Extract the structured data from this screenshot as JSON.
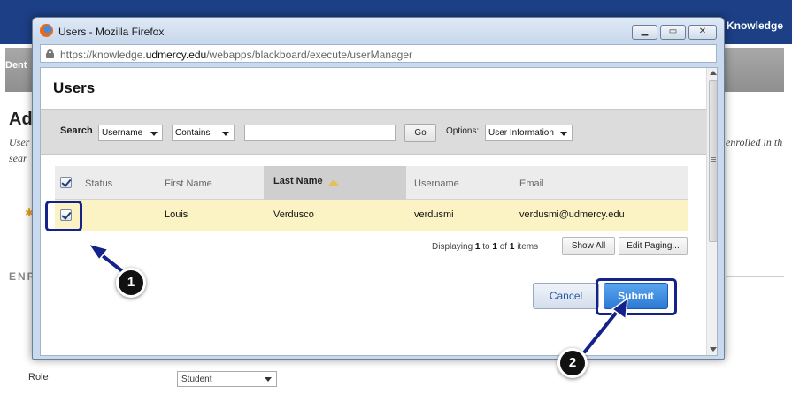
{
  "background_page": {
    "brand_text": "Knowledge",
    "nav_text": "Dent",
    "heading": "Ad",
    "desc_line1": "User",
    "desc_line2": "sear",
    "desc_right": "enrolled in th",
    "section_label": "ENR",
    "role_label": "Role",
    "role_value": "Student"
  },
  "window": {
    "title": "Users - Mozilla Firefox",
    "url_prefix": "https://knowledge.",
    "url_domain": "udmercy.edu",
    "url_suffix": "/webapps/blackboard/execute/userManager"
  },
  "dialog": {
    "title": "Users",
    "search": {
      "label": "Search",
      "field_value": "Username",
      "operator_value": "Contains",
      "query": "",
      "go_label": "Go",
      "options_label": "Options:",
      "options_value": "User Information"
    },
    "table": {
      "columns": [
        "Status",
        "First Name",
        "Last Name",
        "Username",
        "Email"
      ],
      "sorted_column": "Last Name",
      "rows": [
        {
          "checked": true,
          "status": "",
          "first_name": "Louis",
          "last_name": "Verdusco",
          "username": "verdusmi",
          "email": "verdusmi@udmercy.edu"
        }
      ]
    },
    "paging": {
      "prefix": "Displaying ",
      "from": "1",
      "to_word": " to ",
      "to": "1",
      "of_word": " of ",
      "total": "1",
      "suffix": " items",
      "show_all_label": "Show All",
      "edit_paging_label": "Edit Paging..."
    },
    "cancel_label": "Cancel",
    "submit_label": "Submit"
  },
  "annotations": {
    "step1": "1",
    "step2": "2",
    "color": "#13238a"
  }
}
